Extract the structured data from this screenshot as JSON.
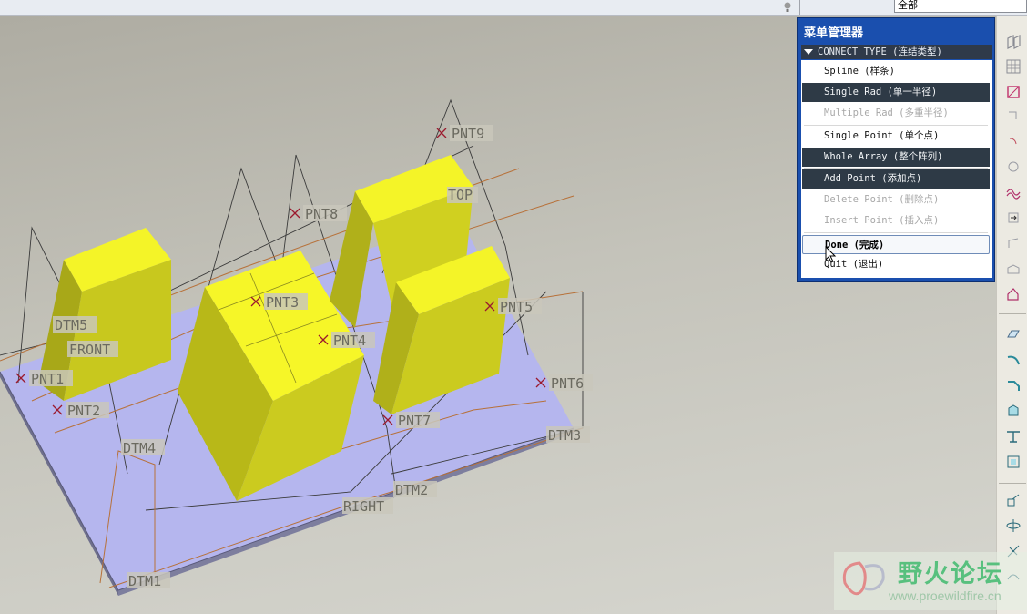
{
  "toolbar_top": {
    "combo_value": "全部"
  },
  "menu": {
    "title": "菜单管理器",
    "header": "CONNECT TYPE (连结类型)",
    "items": [
      {
        "label": "Spline (样条)",
        "state": "normal"
      },
      {
        "label": "Single Rad (单一半径)",
        "state": "active"
      },
      {
        "label": "Multiple Rad (多重半径)",
        "state": "disabled"
      },
      {
        "label": "Single Point (单个点)",
        "state": "normal"
      },
      {
        "label": "Whole Array (整个阵列)",
        "state": "active"
      },
      {
        "label": "Add Point (添加点)",
        "state": "active"
      },
      {
        "label": "Delete Point (删除点)",
        "state": "disabled"
      },
      {
        "label": "Insert Point (插入点)",
        "state": "disabled"
      },
      {
        "label": "Done (完成)",
        "state": "focused"
      },
      {
        "label": "Quit (退出)",
        "state": "normal"
      }
    ]
  },
  "model": {
    "datum_planes": [
      "DTM5",
      "FRONT",
      "TOP",
      "DTM4",
      "RIGHT",
      "DTM2",
      "DTM3",
      "DTM1"
    ],
    "datum_points": [
      "PNT1",
      "PNT2",
      "PNT3",
      "PNT4",
      "PNT5",
      "PNT6",
      "PNT7",
      "PNT8",
      "PNT9"
    ],
    "colors": {
      "block": "#f2f22a",
      "block_side": "#b8b81a",
      "plate": "#b4b4f0",
      "point": "#9b1a2e",
      "datum_curve": "#c07a3a"
    }
  },
  "right_icons": [
    "datum-plane-icon",
    "datum-axis-icon",
    "sketch-icon",
    "datum-point-icon",
    "datum-curve-icon",
    "coordinate-system-icon",
    "analysis-icon",
    "placement-icon",
    "mirror-icon",
    "trim-icon",
    "extrude-icon",
    "hole-icon",
    "round-icon",
    "chamfer-icon",
    "shell-icon",
    "rib-icon",
    "draft-icon",
    "pattern-icon",
    "copy-icon",
    "rotate-icon",
    "sweep-icon"
  ],
  "watermark": {
    "title": "野火论坛",
    "url": "www.proewildfire.cn"
  }
}
